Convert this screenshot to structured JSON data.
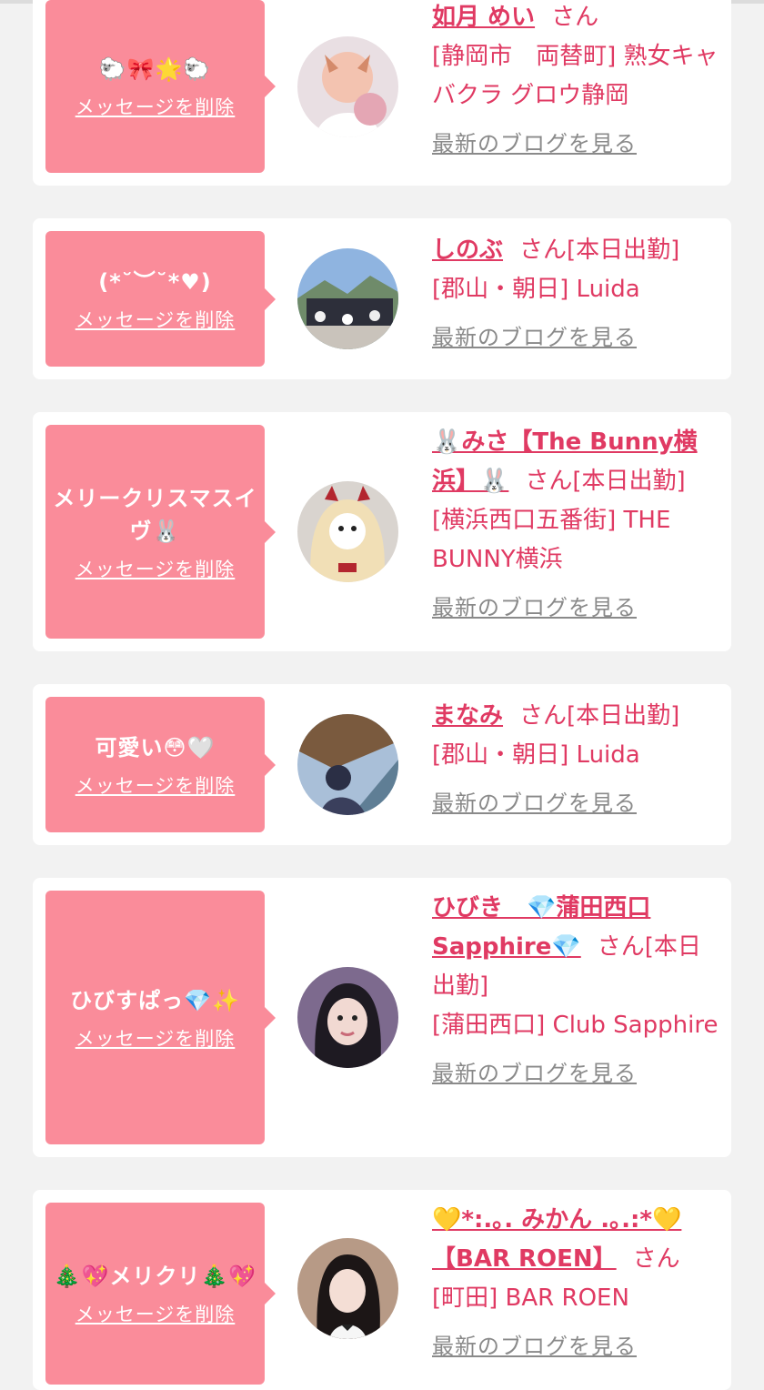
{
  "delete_label": "メッセージを削除",
  "blog_label": "最新のブログを見る",
  "san": "さん",
  "colors": {
    "bubble": "#fa8c9a",
    "accent": "#e03a63",
    "muted": "#8a8a8a",
    "background": "#f2f2f2"
  },
  "cards": [
    {
      "message": "🐑🎀🌟🐑",
      "name": "如月 めい",
      "status": "",
      "shop": "[静岡市　両替町] 熟女キャバクラ グロウ静岡"
    },
    {
      "message": "(*˘︶˘*♥)",
      "name": "しのぶ",
      "status": "[本日出勤]",
      "shop": "[郡山・朝日] Luida"
    },
    {
      "message": "メリークリスマスイヴ🐰",
      "name": "🐰みさ【The Bunny横浜】🐰",
      "status": "[本日出勤]",
      "shop": "[横浜西口五番街] THE BUNNY横浜"
    },
    {
      "message": "可愛い😳🤍",
      "name": "まなみ",
      "status": "[本日出勤]",
      "shop": "[郡山・朝日] Luida"
    },
    {
      "message": "ひびすぱっ💎✨",
      "name": "ひびき　💎蒲田西口Sapphire💎",
      "status": "[本日出勤]",
      "shop": "[蒲田西口] Club Sapphire"
    },
    {
      "message": "🎄💖メリクリ🎄💖",
      "name": "💛*:.｡. みかん .｡.:*💛【BAR ROEN】",
      "status": "",
      "shop": "[町田] BAR ROEN"
    }
  ]
}
